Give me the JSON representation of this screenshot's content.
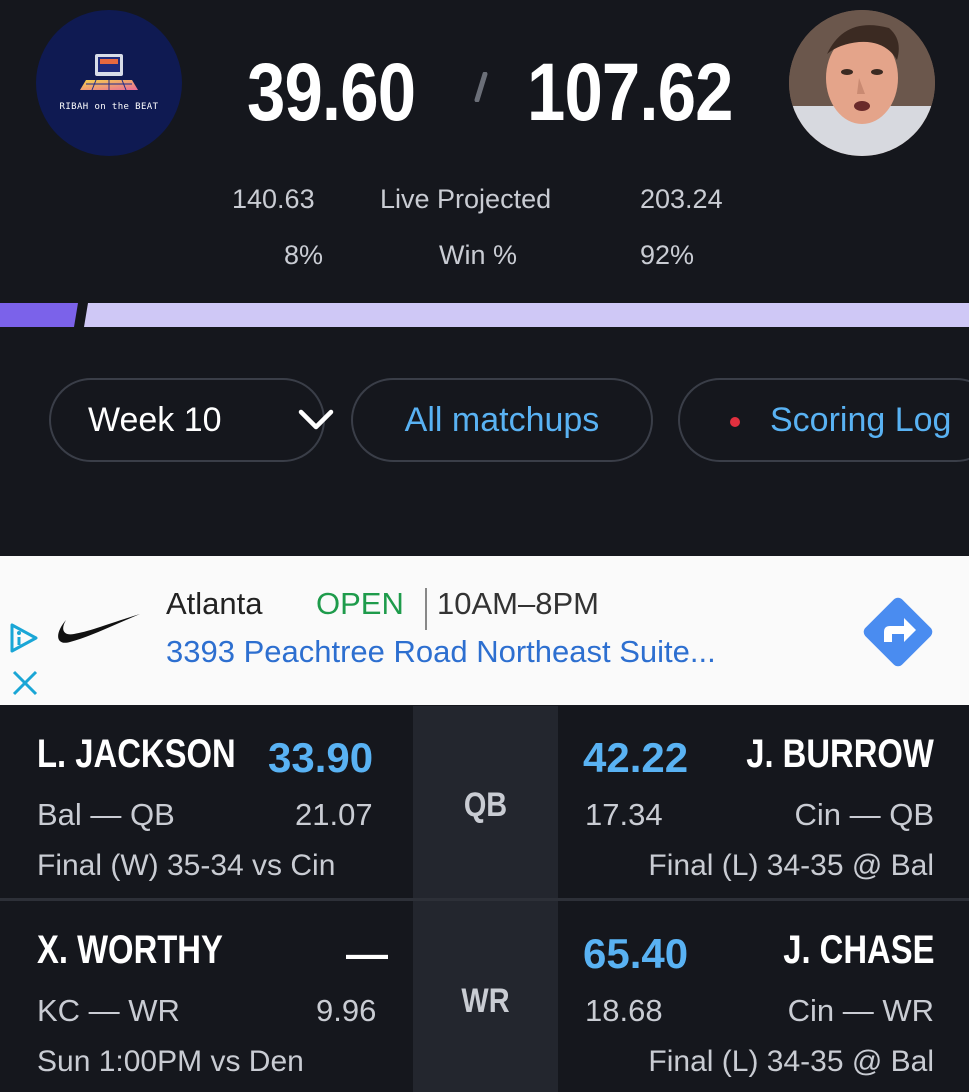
{
  "header": {
    "team_logo_text": "RIBAH on the BEAT",
    "my_score": "39.60",
    "opp_score": "107.62",
    "my_projected": "140.63",
    "projected_label": "Live Projected",
    "opp_projected": "203.24",
    "my_win_pct": "8%",
    "win_label": "Win %",
    "opp_win_pct": "92%",
    "win_probability_left": 0.08
  },
  "filters": {
    "week_label": "Week 10",
    "all_matchups_label": "All matchups",
    "scoring_log_label": "Scoring Log"
  },
  "ad": {
    "city": "Atlanta",
    "open_status": "OPEN",
    "hours": "10AM–8PM",
    "address": "3393 Peachtree Road Northeast Suite..."
  },
  "matchups": [
    {
      "position": "QB",
      "left": {
        "name": "L. JACKSON",
        "points": "33.90",
        "team_pos": "Bal — QB",
        "projection": "21.07",
        "status": "Final (W) 35-34 vs Cin"
      },
      "right": {
        "name": "J. BURROW",
        "points": "42.22",
        "team_pos": "Cin — QB",
        "projection": "17.34",
        "status": "Final (L) 34-35 @ Bal"
      }
    },
    {
      "position": "WR",
      "left": {
        "name": "X. WORTHY",
        "points": "—",
        "team_pos": "KC — WR",
        "projection": "9.96",
        "status": "Sun 1:00PM  vs Den"
      },
      "right": {
        "name": "J. CHASE",
        "points": "65.40",
        "team_pos": "Cin — WR",
        "projection": "18.68",
        "status": "Final (L) 34-35 @ Bal"
      }
    }
  ],
  "colors": {
    "background": "#15171d",
    "accent_blue": "#59b2f3",
    "winbar_left": "#7b62ea",
    "winbar_right": "#cfc8f6",
    "open_green": "#1e9b4b"
  }
}
